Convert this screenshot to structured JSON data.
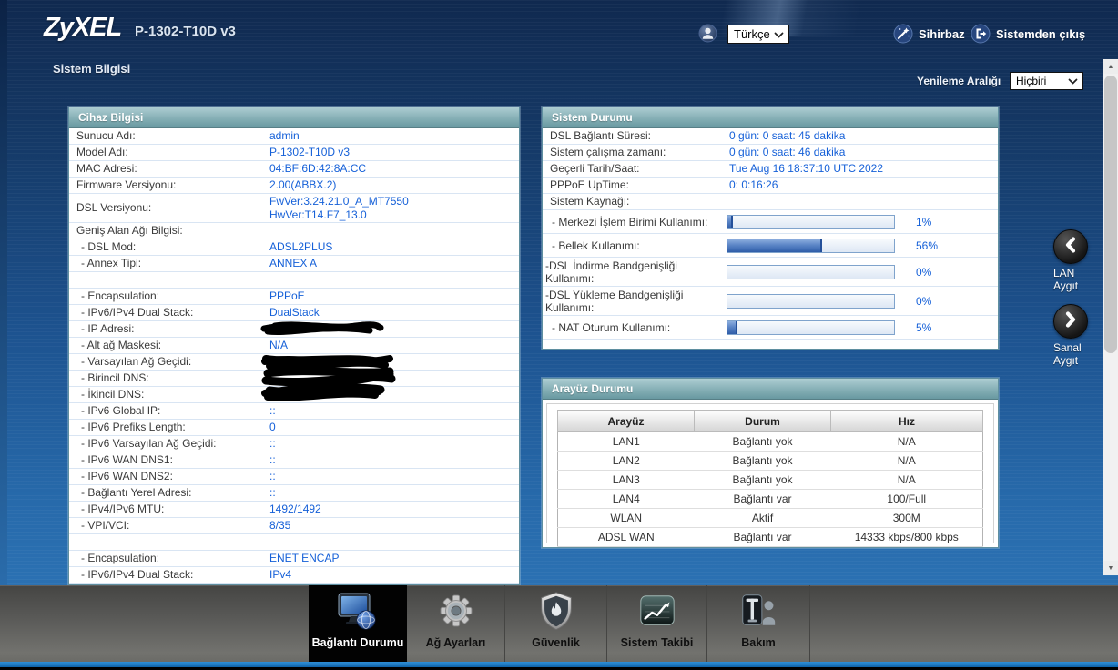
{
  "header": {
    "brand": "ZyXEL",
    "model": "P-1302-T10D v3",
    "language_select": {
      "value": "Türkçe",
      "icon": "user-icon"
    },
    "links": [
      {
        "name": "wizard",
        "label": "Sihirbaz",
        "icon": "wizard-icon"
      },
      {
        "name": "logout",
        "label": "Sistemden çıkış",
        "icon": "logout-icon"
      }
    ]
  },
  "page": {
    "title": "Sistem Bilgisi",
    "refresh_label": "Yenileme Aralığı",
    "refresh_select": {
      "value": "Hiçbiri"
    }
  },
  "device_info": {
    "title": "Cihaz Bilgisi",
    "rows": [
      {
        "label": "Sunucu Adı:",
        "value": "admin"
      },
      {
        "label": "Model Adı:",
        "value": "P-1302-T10D v3"
      },
      {
        "label": "MAC Adresi:",
        "value": "04:BF:6D:42:8A:CC"
      },
      {
        "label": "Firmware Versiyonu:",
        "value": "2.00(ABBX.2)"
      },
      {
        "label": "DSL Versiyonu:",
        "value": "FwVer:3.24.21.0_A_MT7550\nHwVer:T14.F7_13.0",
        "tall": true
      },
      {
        "label": "Geniş Alan Ağı Bilgisi:",
        "value": ""
      },
      {
        "label": "- DSL Mod:",
        "value": "ADSL2PLUS"
      },
      {
        "label": "- Annex Tipi:",
        "value": "ANNEX A"
      },
      {
        "label": "",
        "value": ""
      },
      {
        "label": "- Encapsulation:",
        "value": "PPPoE"
      },
      {
        "label": "- IPv6/IPv4 Dual Stack:",
        "value": "DualStack"
      },
      {
        "label": "- IP Adresi:",
        "value": "",
        "redacted": true,
        "redaction": "sm"
      },
      {
        "label": "- Alt ağ Maskesi:",
        "value": "N/A"
      },
      {
        "label": "- Varsayılan Ağ Geçidi:",
        "value": "",
        "redacted": true,
        "redaction": "md"
      },
      {
        "label": "- Birincil DNS:",
        "value": "",
        "redacted": true,
        "redaction": "lg"
      },
      {
        "label": "- İkincil DNS:",
        "value": "",
        "redacted": true,
        "redaction": "xl"
      },
      {
        "label": "- IPv6 Global IP:",
        "value": "::"
      },
      {
        "label": "- IPv6 Prefiks Length:",
        "value": "0"
      },
      {
        "label": "- IPv6 Varsayılan Ağ Geçidi:",
        "value": "::"
      },
      {
        "label": "- IPv6 WAN DNS1:",
        "value": "::"
      },
      {
        "label": "- IPv6 WAN DNS2:",
        "value": "::"
      },
      {
        "label": "- Bağlantı Yerel Adresi:",
        "value": "::"
      },
      {
        "label": "- IPv4/IPv6 MTU:",
        "value": "1492/1492"
      },
      {
        "label": "- VPI/VCI:",
        "value": "8/35"
      },
      {
        "label": "",
        "value": ""
      },
      {
        "label": "- Encapsulation:",
        "value": "ENET ENCAP"
      },
      {
        "label": "- IPv6/IPv4 Dual Stack:",
        "value": "IPv4"
      }
    ]
  },
  "system_status": {
    "title": "Sistem Durumu",
    "rows": [
      {
        "label": "DSL Bağlantı Süresi:",
        "value": "0 gün: 0 saat: 45 dakika"
      },
      {
        "label": "Sistem çalışma zamanı:",
        "value": "0 gün: 0 saat: 46 dakika"
      },
      {
        "label": "Geçerli Tarih/Saat:",
        "value": "Tue Aug 16 18:37:10 UTC 2022"
      },
      {
        "label": "PPPoE UpTime:",
        "value": "0: 0:16:26"
      },
      {
        "label": "Sistem Kaynağı:",
        "value": ""
      }
    ],
    "resources": [
      {
        "label": "- Merkezi İşlem Birimi Kullanımı:",
        "percent": 1,
        "display": "1%"
      },
      {
        "label": "- Bellek Kullanımı:",
        "percent": 56,
        "display": "56%"
      },
      {
        "label": "-DSL İndirme Bandgenişliği\nKullanımı:",
        "percent": 0,
        "display": "0%",
        "tall": true
      },
      {
        "label": "-DSL Yükleme Bandgenişliği\nKullanımı:",
        "percent": 0,
        "display": "0%",
        "tall": true
      },
      {
        "label": "- NAT Oturum Kullanımı:",
        "percent": 5,
        "display": "5%"
      }
    ]
  },
  "interface_status": {
    "title": "Arayüz Durumu",
    "columns": [
      "Arayüz",
      "Durum",
      "Hız"
    ],
    "rows": [
      [
        "LAN1",
        "Bağlantı yok",
        "N/A"
      ],
      [
        "LAN2",
        "Bağlantı yok",
        "N/A"
      ],
      [
        "LAN3",
        "Bağlantı yok",
        "N/A"
      ],
      [
        "LAN4",
        "Bağlantı var",
        "100/Full"
      ],
      [
        "WLAN",
        "Aktif",
        "300M"
      ],
      [
        "ADSL WAN",
        "Bağlantı var",
        "14333 kbps/800 kbps"
      ]
    ]
  },
  "side_buttons": [
    {
      "name": "lan-device",
      "label": "LAN\nAygıt",
      "icon": "chevron-left-icon"
    },
    {
      "name": "virtual-device",
      "label": "Sanal\nAygıt",
      "icon": "chevron-right-icon"
    }
  ],
  "nav": {
    "items": [
      {
        "name": "connection-status",
        "label": "Bağlantı Durumu",
        "icon": "connection-status-icon",
        "active": true
      },
      {
        "name": "network-settings",
        "label": "Ağ Ayarları",
        "icon": "network-settings-icon",
        "active": false
      },
      {
        "name": "security",
        "label": "Güvenlik",
        "icon": "security-icon",
        "active": false
      },
      {
        "name": "system-monitor",
        "label": "Sistem Takibi",
        "icon": "system-monitor-icon",
        "active": false
      },
      {
        "name": "maintenance",
        "label": "Bakım",
        "icon": "maintenance-icon",
        "active": false
      }
    ]
  },
  "colors": {
    "value_blue": "#1560d8",
    "panel_header_teal": "#6899a1",
    "page_bg_top": "#10294f",
    "page_bg_bottom": "#2f78ba",
    "nav_active_bg": "#000000",
    "bottom_strip_blue": "#1b79c0"
  }
}
